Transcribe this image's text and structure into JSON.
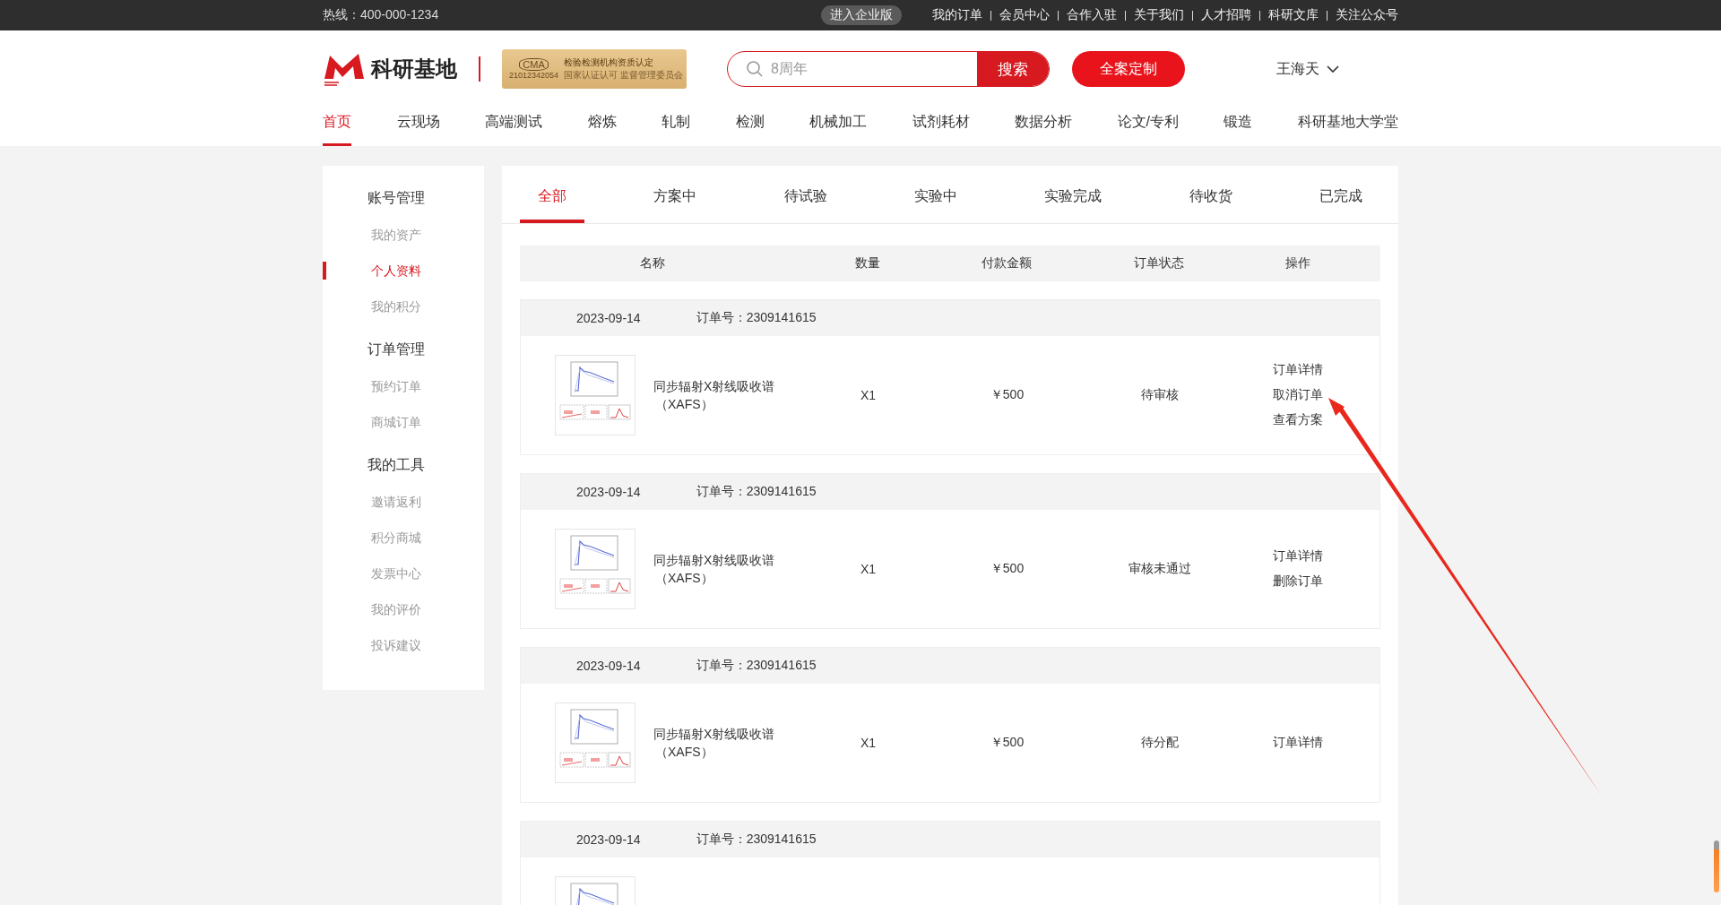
{
  "top_bar": {
    "hotline": "热线：400-000-1234",
    "enterprise_button": "进入企业版",
    "links": [
      "我的订单",
      "会员中心",
      "合作入驻",
      "关于我们",
      "人才招聘",
      "科研文库",
      "关注公众号"
    ]
  },
  "header": {
    "logo_text": "科研基地",
    "badge": {
      "mark": "CMA",
      "title": "检验检测机构资质认定",
      "code": "21012342054",
      "subtitle": "国家认证认可 监督管理委员会"
    },
    "search": {
      "placeholder": "8周年",
      "button": "搜索"
    },
    "custom_button": "全案定制",
    "user_name": "王海天"
  },
  "nav": [
    {
      "label": "首页",
      "selected": true
    },
    {
      "label": "云现场",
      "selected": false
    },
    {
      "label": "高端测试",
      "selected": false
    },
    {
      "label": "熔炼",
      "selected": false
    },
    {
      "label": "轧制",
      "selected": false
    },
    {
      "label": "检测",
      "selected": false
    },
    {
      "label": "机械加工",
      "selected": false
    },
    {
      "label": "试剂耗材",
      "selected": false
    },
    {
      "label": "数据分析",
      "selected": false
    },
    {
      "label": "论文/专利",
      "selected": false
    },
    {
      "label": "锻造",
      "selected": false
    },
    {
      "label": "科研基地大学堂",
      "selected": false
    }
  ],
  "sidebar": [
    {
      "heading": "账号管理",
      "items": [
        {
          "label": "我的资产",
          "selected": false
        },
        {
          "label": "个人资料",
          "selected": true
        },
        {
          "label": "我的积分",
          "selected": false
        }
      ]
    },
    {
      "heading": "订单管理",
      "items": [
        {
          "label": "预约订单",
          "selected": false
        },
        {
          "label": "商城订单",
          "selected": false
        }
      ]
    },
    {
      "heading": "我的工具",
      "items": [
        {
          "label": "邀请返利",
          "selected": false
        },
        {
          "label": "积分商城",
          "selected": false
        },
        {
          "label": "发票中心",
          "selected": false
        },
        {
          "label": "我的评价",
          "selected": false
        },
        {
          "label": "投诉建议",
          "selected": false
        }
      ]
    }
  ],
  "tabs": [
    {
      "label": "全部",
      "selected": true
    },
    {
      "label": "方案中",
      "selected": false
    },
    {
      "label": "待试验",
      "selected": false
    },
    {
      "label": "实验中",
      "selected": false
    },
    {
      "label": "实验完成",
      "selected": false
    },
    {
      "label": "待收货",
      "selected": false
    },
    {
      "label": "已完成",
      "selected": false
    }
  ],
  "table": {
    "columns": [
      "名称",
      "数量",
      "付款金额",
      "订单状态",
      "操作"
    ],
    "orders": [
      {
        "date": "2023-09-14",
        "order_no": "订单号：2309141615",
        "name_line_1": "同步辐射X射线吸收谱",
        "name_line_2": "（XAFS）",
        "quantity": "X1",
        "amount": "￥500",
        "status": "待审核",
        "actions": [
          "订单详情",
          "取消订单",
          "查看方案"
        ]
      },
      {
        "date": "2023-09-14",
        "order_no": "订单号：2309141615",
        "name_line_1": "同步辐射X射线吸收谱",
        "name_line_2": "（XAFS）",
        "quantity": "X1",
        "amount": "￥500",
        "status": "审核未通过",
        "actions": [
          "订单详情",
          "删除订单"
        ]
      },
      {
        "date": "2023-09-14",
        "order_no": "订单号：2309141615",
        "name_line_1": "同步辐射X射线吸收谱",
        "name_line_2": "（XAFS）",
        "quantity": "X1",
        "amount": "￥500",
        "status": "待分配",
        "actions": [
          "订单详情"
        ]
      },
      {
        "date": "2023-09-14",
        "order_no": "订单号：2309141615"
      }
    ]
  }
}
